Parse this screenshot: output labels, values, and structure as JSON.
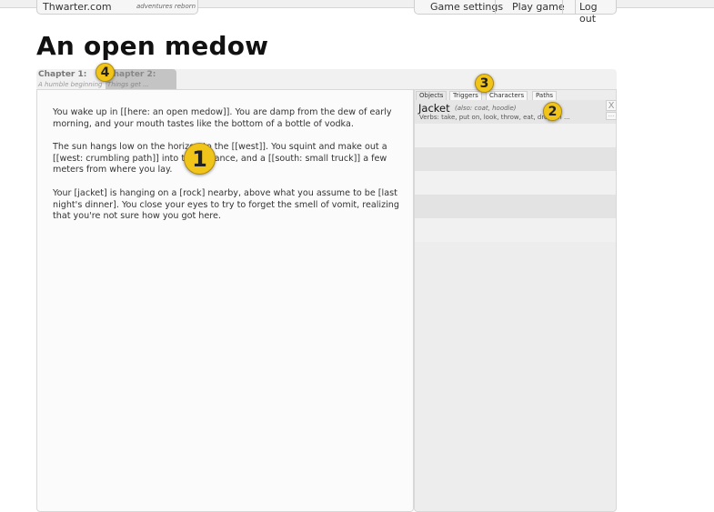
{
  "header": {
    "site_name": "Thwarter.com",
    "tagline": "adventures reborn",
    "nav": [
      "Game settings",
      "Play game",
      "Log out"
    ]
  },
  "page": {
    "title": "An open medow"
  },
  "chapters": [
    {
      "name": "Chapter 1:",
      "desc": "A humble beginning"
    },
    {
      "name": "Chapter 2:",
      "desc": "Things get ..."
    }
  ],
  "story": {
    "paragraphs": [
      "You wake up in [[here: an open medow]].  You are damp from the dew of early morning, and your mouth tastes like the bottom of a bottle of vodka.",
      "The sun hangs low on the horizon to the [[west]].  You squint and make out a [[west: crumbling path]] into the distance, and a [[south: small truck]] a few meters from where you lay.",
      "Your [jacket] is hanging on a [rock] nearby, above what you assume to be [last night's dinner].  You close your eyes to try to forget the smell of vomit, realizing that you're not sure how you got here."
    ]
  },
  "side_panel": {
    "tabs": [
      "Objects",
      "Triggers",
      "Characters",
      "Paths"
    ],
    "active_tab": "Objects",
    "objects": [
      {
        "name": "Jacket",
        "also": "(also: coat, hoodie)",
        "verbs": "Verbs: take, put on, look, throw, eat, drop on ..."
      }
    ],
    "close_label": "X",
    "more_label": "..."
  },
  "badges": [
    "1",
    "2",
    "3",
    "4"
  ],
  "colors": {
    "badge": "#f0c419",
    "panel_bg": "#ededed",
    "active_chapter": "#c4c4c4"
  }
}
